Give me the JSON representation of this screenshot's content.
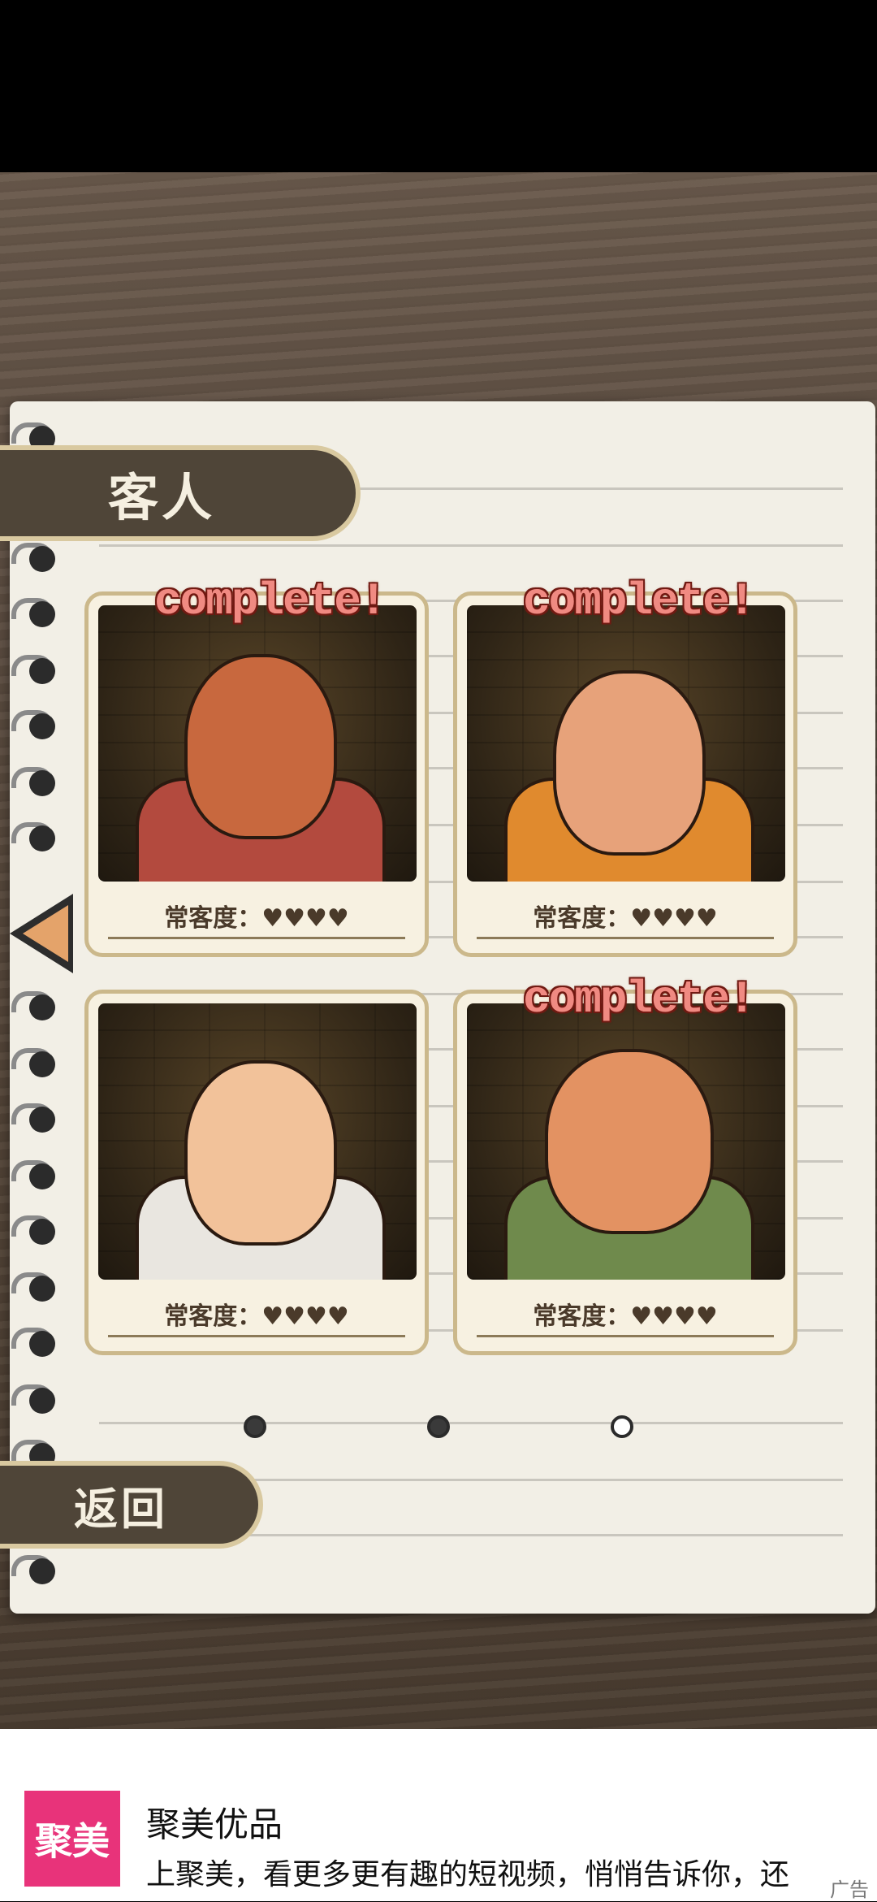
{
  "header": {
    "title": "客人"
  },
  "cards": [
    {
      "complete": "complete!",
      "loyalty_label": "常客度：♥♥♥♥"
    },
    {
      "complete": "complete!",
      "loyalty_label": "常客度：♥♥♥♥"
    },
    {
      "complete": "",
      "loyalty_label": "常客度：♥♥♥♥"
    },
    {
      "complete": "complete!",
      "loyalty_label": "常客度：♥♥♥♥"
    }
  ],
  "pagination": {
    "current_page": 3,
    "total_pages": 3
  },
  "buttons": {
    "back": "返回"
  },
  "ad": {
    "brand_logo": "聚美",
    "title": "聚美优品",
    "description": "上聚美，看更多更有趣的短视频，悄悄告诉你，还",
    "tag": "广告"
  }
}
